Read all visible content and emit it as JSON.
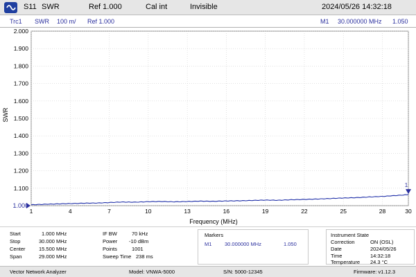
{
  "topbar": {
    "measurement": "S11",
    "format": "SWR",
    "ref": "Ref  1.000",
    "cal": "Cal int",
    "visibility": "Invisible",
    "datetime": "2024/05/26  14:32:18"
  },
  "trace": {
    "name": "Trc1",
    "format": "SWR",
    "scale": "100  m/",
    "ref": "Ref  1.000",
    "marker_name": "M1",
    "marker_freq": "30.000000  MHz",
    "marker_value": "1.050"
  },
  "chart_data": {
    "type": "line",
    "ylabel": "SWR",
    "xlabel": "Frequency  (MHz)",
    "xlim": [
      1,
      30
    ],
    "ylim": [
      1.0,
      2.0
    ],
    "x_ticks": [
      1,
      4,
      7,
      10,
      13,
      16,
      19,
      22,
      25,
      28,
      30
    ],
    "y_ticks": [
      "2.000",
      "1.900",
      "1.800",
      "1.700",
      "1.600",
      "1.500",
      "1.400",
      "1.300",
      "1.200",
      "1.100",
      "1.000"
    ],
    "ref_marker_label": "1.000",
    "marker_label": "1",
    "marker_x": 30,
    "marker_y": 1.063,
    "series": [
      {
        "color": "#1f2fa8",
        "x": [
          1,
          2,
          3,
          4,
          5,
          6,
          7,
          8,
          9,
          10,
          11,
          12,
          13,
          14,
          15,
          16,
          17,
          18,
          19,
          20,
          21,
          22,
          23,
          24,
          25,
          26,
          27,
          28,
          29,
          30
        ],
        "y": [
          1.005,
          1.008,
          1.01,
          1.012,
          1.014,
          1.015,
          1.018,
          1.021,
          1.02,
          1.023,
          1.024,
          1.022,
          1.024,
          1.026,
          1.025,
          1.027,
          1.028,
          1.03,
          1.032,
          1.031,
          1.034,
          1.036,
          1.038,
          1.041,
          1.044,
          1.046,
          1.05,
          1.053,
          1.058,
          1.063
        ]
      }
    ],
    "grid": true
  },
  "sweep": {
    "rows": [
      {
        "label": "Start",
        "value": "1.000  MHz"
      },
      {
        "label": "Stop",
        "value": "30.000  MHz"
      },
      {
        "label": "Center",
        "value": "15.500  MHz"
      },
      {
        "label": "Span",
        "value": "29.000  MHz"
      }
    ]
  },
  "params": {
    "rows": [
      {
        "label": "IF BW",
        "value": "70  kHz"
      },
      {
        "label": "Power",
        "value": "-10  dBm"
      },
      {
        "label": "Points",
        "value": "1001"
      },
      {
        "label": "Sweep Time",
        "value": "238  ms"
      }
    ]
  },
  "markers": {
    "title": "Markers",
    "name": "M1",
    "freq": "30.000000  MHz",
    "value": "1.050"
  },
  "instrument_state": {
    "title": "Instrument State",
    "rows": [
      {
        "label": "Correction",
        "value": "ON  (OSL)"
      },
      {
        "label": "Date",
        "value": "2024/05/26"
      },
      {
        "label": "Time",
        "value": "14:32:18"
      },
      {
        "label": "Temperature",
        "value": "24.3  °C"
      }
    ]
  },
  "statusbar": {
    "app": "Vector Network Analyzer",
    "model": "Model:  VNWA-5000",
    "serial": "S/N:  5000-12345",
    "firmware": "Firmware:  v1.12.3"
  },
  "colors": {
    "trace": "#1f2fa8",
    "accent_blue": "#2a2f9e",
    "grid": "#d0d0d0"
  }
}
